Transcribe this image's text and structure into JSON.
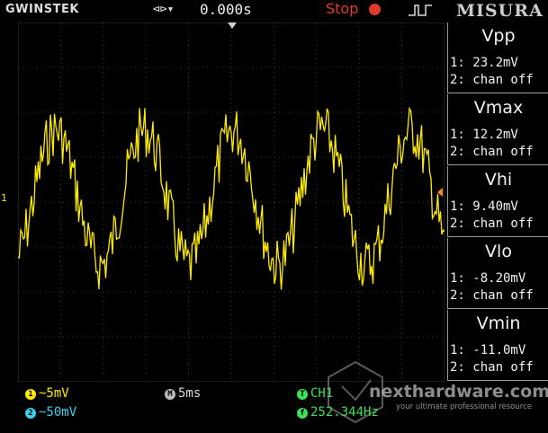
{
  "header": {
    "brand": "GWINSTEK",
    "trigger_icon": "trigger-arrows-icon",
    "trigger_time": "0.000s",
    "run_state": "Stop",
    "run_state_color": "#e03a2a",
    "misura": "MISURA"
  },
  "display": {
    "ch1_marker": "1",
    "trace_color": "#ffeb00",
    "grid_color": "#4a4a4a"
  },
  "measurements": [
    {
      "title": "Vpp",
      "ch1": "1: 23.2mV",
      "ch2": "2: chan off"
    },
    {
      "title": "Vmax",
      "ch1": "1: 12.2mV",
      "ch2": "2: chan off"
    },
    {
      "title": "Vhi",
      "ch1": "1: 9.40mV",
      "ch2": "2: chan off"
    },
    {
      "title": "Vlo",
      "ch1": "1: -8.20mV",
      "ch2": "2: chan off"
    },
    {
      "title": "Vmin",
      "ch1": "1: -11.0mV",
      "ch2": "2: chan off"
    }
  ],
  "status": {
    "ch1_badge": "1",
    "ch1_scale": "~5mV",
    "ch2_badge": "2",
    "ch2_scale": "~50mV",
    "timebase_badge": "M",
    "timebase": "5ms",
    "trigger_badge": "T",
    "trigger_source": "CH1",
    "freq_badge": "f",
    "frequency": "252.344Hz",
    "ch1_color": "#ffeb00",
    "ch2_color": "#3ad0f0",
    "trigger_color": "#3ce05a"
  },
  "watermark": {
    "name": "nexthardware.com",
    "tagline": "your ultimate professional resource"
  }
}
